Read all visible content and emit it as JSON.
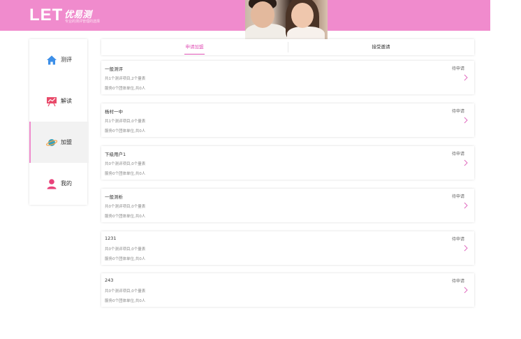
{
  "header": {
    "logo_mark": "LET",
    "logo_name": "优易测",
    "logo_slogan": "专业的测评管理的选择",
    "background": "#f08bcd"
  },
  "sidebar": {
    "items": [
      {
        "label": "测评",
        "icon": "home-icon",
        "active": false
      },
      {
        "label": "解读",
        "icon": "chart-board-icon",
        "active": false
      },
      {
        "label": "加盟",
        "icon": "planet-icon",
        "active": true
      },
      {
        "label": "我的",
        "icon": "user-icon",
        "active": false
      }
    ]
  },
  "tabs": {
    "items": [
      {
        "label": "申请加盟",
        "active": true
      },
      {
        "label": "接受邀请",
        "active": false
      }
    ],
    "accent": "#e052b6"
  },
  "cards": [
    {
      "name": "一般测评",
      "status": "待申请",
      "line1": "共1个测评项目,2个量表",
      "line2": "服务0个团体单位,共0人"
    },
    {
      "name": "杨村一中",
      "status": "待申请",
      "line1": "共1个测评项目,0个量表",
      "line2": "服务0个团体单位,共0人"
    },
    {
      "name": "下级用户1",
      "status": "待申请",
      "line1": "共0个测评项目,0个量表",
      "line2": "服务0个团体单位,共0人"
    },
    {
      "name": "一般测析",
      "status": "待申请",
      "line1": "共0个测评项目,0个量表",
      "line2": "服务0个团体单位,共0人"
    },
    {
      "name": "1231",
      "status": "待申请",
      "line1": "共0个测评项目,0个量表",
      "line2": "服务0个团体单位,共0人"
    },
    {
      "name": "243",
      "status": "待申请",
      "line1": "共0个测评项目,0个量表",
      "line2": "服务0个团体单位,共0人"
    }
  ]
}
